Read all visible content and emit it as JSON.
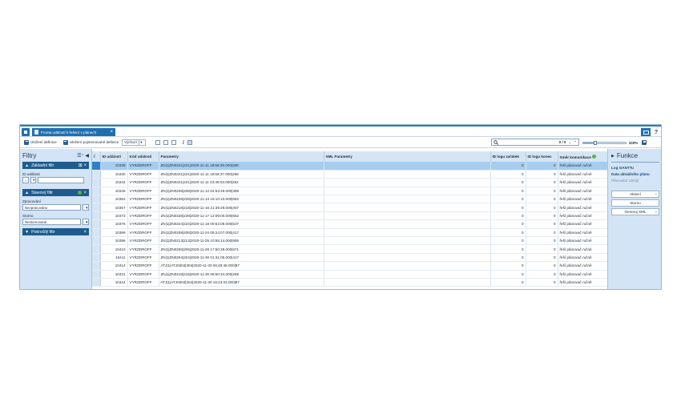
{
  "tab": {
    "label": "Fronta událostí k řešení v plánech"
  },
  "topbar": {
    "help_icon": "?"
  },
  "toolbar": {
    "save_label": "Uložení definice",
    "save_named_label": "Uložení pojmenované definice",
    "definition_select": "Výchozí"
  },
  "search": {
    "counter": "0 / 0"
  },
  "zoom": {
    "value": "100%",
    "level": 0.28
  },
  "filters": {
    "title": "Filtry",
    "basic": {
      "title": "Základní filtr",
      "id_label": "ID události",
      "operator": "="
    },
    "status": {
      "title": "Stavový filtr",
      "processed_label": "Zpracování",
      "processed_value": "Nezpracováno",
      "cancel_label": "Storno",
      "cancel_value": "Nestornované"
    },
    "advanced": {
      "title": "Pokročilý filtr"
    }
  },
  "grid": {
    "columns": [
      "ID události",
      "Kód události",
      "Parametry",
      "XML Parametry",
      "ID logu začátek",
      "ID logu konec",
      "Směr komunikace"
    ],
    "rows": [
      [
        "10339",
        "VYRZDROFF",
        "ZN|1|ZN0221|221|2020-11-11 18:58:29.000|268",
        "",
        "0",
        "0",
        "řeší plánovač ručně"
      ],
      [
        "10340",
        "VYRZDROFF",
        "ZN|1|ZN0221|221|2020-11-11 18:58:37.000|268",
        "",
        "0",
        "0",
        "řeší plánovač ručně"
      ],
      [
        "10342",
        "VYRZDROFF",
        "ZN|1|ZN0221|221|2020-11-11 23:48:03.000|262",
        "",
        "0",
        "0",
        "řeší plánovač ručně"
      ],
      [
        "10345",
        "VYRZDROFF",
        "ZN|1|ZN0208|208|2020-11-12 04:53:49.000|396",
        "",
        "0",
        "0",
        "řeší plánovač ručně"
      ],
      [
        "10362",
        "VYRZDROFF",
        "ZN|1|ZN0228|228|2020-11-13 16:10:10.000|662",
        "",
        "0",
        "0",
        "řeší plánovač ručně"
      ],
      [
        "10367",
        "VYRZDROFF",
        "ZN|1|ZN0218|218|2020-11-16 21:39:29.000|407",
        "",
        "0",
        "0",
        "řeší plánovač ručně"
      ],
      [
        "10373",
        "VYRZDROFF",
        "ZN|1|ZN0228|228|2020-11-17 12:09:00.000|662",
        "",
        "0",
        "0",
        "řeší plánovač ručně"
      ],
      [
        "10376",
        "VYRZDROFF",
        "ZN|1|ZN0224|224|2020-11-18 09:52:08.000|537",
        "",
        "0",
        "0",
        "řeší plánovač ručně"
      ],
      [
        "10389",
        "VYRZDROFF",
        "ZN|1|ZN0208|208|2020-11-24 05:24:07.000|417",
        "",
        "0",
        "0",
        "řeší plánovač ručně"
      ],
      [
        "10396",
        "VYRZDROFF",
        "ZN|1|ZN0213|213|2020-11-25 10:55:14.000|555",
        "",
        "0",
        "0",
        "řeší plánovač ručně"
      ],
      [
        "10410",
        "VYRZDROFF",
        "ZN|1|ZN0206|206|2020-11-28 17:50:39.000|671",
        "",
        "0",
        "0",
        "řeší plánovač ručně"
      ],
      [
        "10411",
        "VYRZDROFF",
        "ZN|1|ZN0204|204|2020-11-30 01:31:05.000|417",
        "",
        "0",
        "0",
        "řeší plánovač ručně"
      ],
      [
        "10414",
        "VYRZDROFF",
        "ATJ|1|ATJ0304|304|2020-11-30 06:49:48.000|87",
        "",
        "0",
        "0",
        "řeší plánovač ručně"
      ],
      [
        "10421",
        "VYRZDROFF",
        "ZN|1|ZN0218|218|2020-11-30 08:50:34.000|268",
        "",
        "0",
        "0",
        "řeší plánovač ručně"
      ],
      [
        "10424",
        "VYRZDROFF",
        "ATJ|1|ATJ0304|304|2020-11-30 16:23:03.000|87",
        "",
        "0",
        "0",
        "řeší plánovač ručně"
      ]
    ]
  },
  "functions": {
    "title": "Funkce",
    "links": [
      "Log GANTTu",
      "Data aktuálního plánu",
      "Plánování zdrojů"
    ],
    "buttons": [
      "Aktivní",
      "Storno",
      "Generuj XML"
    ]
  },
  "colors": {
    "accent": "#1f6fb0",
    "panel": "#d2e4f5",
    "selected_row": "#a6cdf0",
    "header": "#1e5b8e"
  }
}
